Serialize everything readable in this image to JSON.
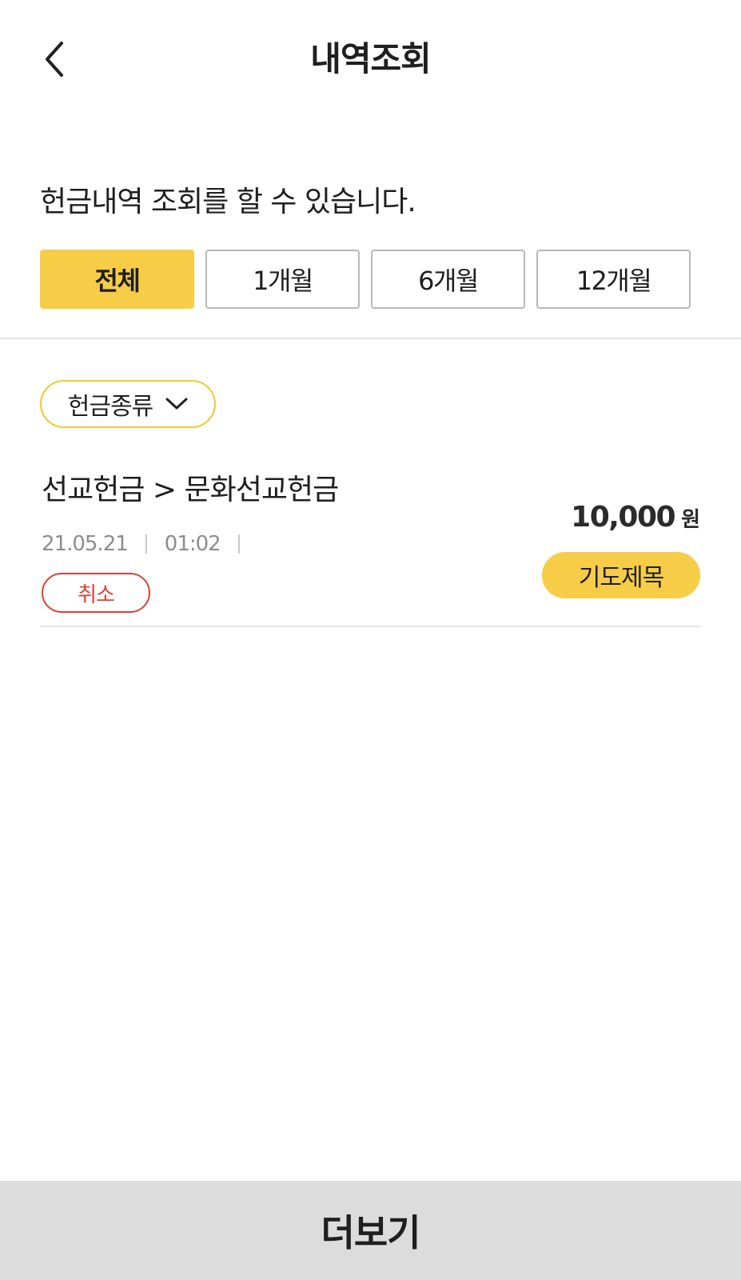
{
  "header": {
    "title": "내역조회",
    "back_icon": "chevron-left-icon"
  },
  "description": "헌금내역 조회를 할 수 있습니다.",
  "period_filter": {
    "options": [
      "전체",
      "1개월",
      "6개월",
      "12개월"
    ],
    "selected": "전체"
  },
  "type_filter": {
    "label": "헌금종류",
    "icon": "chevron-down-icon"
  },
  "transactions": [
    {
      "title": "선교헌금 > 문화선교헌금",
      "date": "21.05.21",
      "time": "01:02",
      "status": "취소",
      "amount": "10,000",
      "currency": "원",
      "action_label": "기도제목"
    }
  ],
  "more_label": "더보기",
  "colors": {
    "accent": "#f7cc47",
    "chip_border": "#f1c933",
    "cancel": "#d94236",
    "more_bg": "#dcdcdc"
  }
}
